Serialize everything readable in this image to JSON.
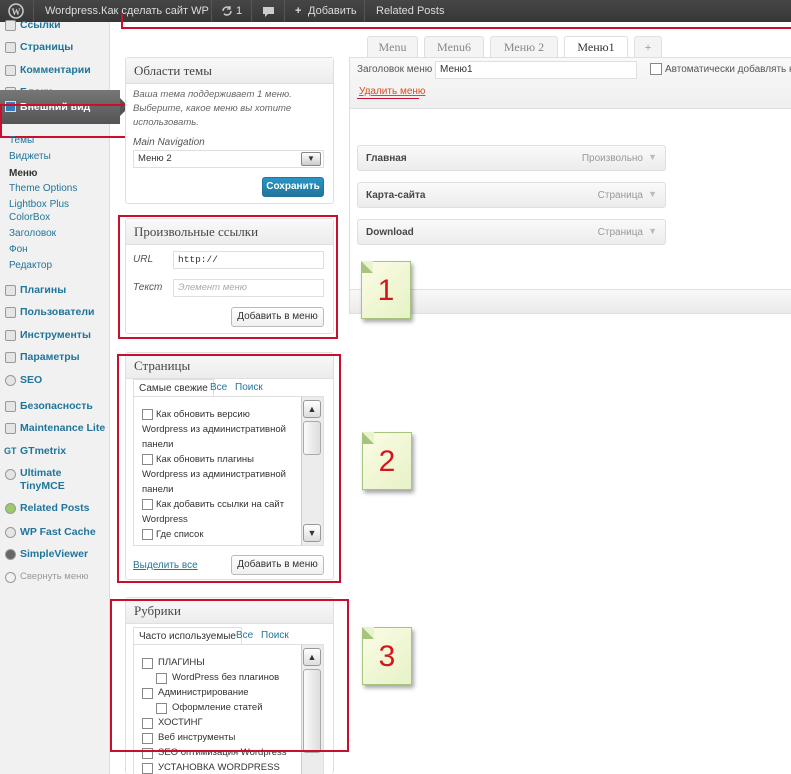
{
  "adminbar": {
    "site_title": "Wordpress.Как сделать сайт WP",
    "updates_count": "1",
    "add_label": "Добавить",
    "related_posts": "Related Posts"
  },
  "sidebar": {
    "top_items": [
      "Ссылки",
      "Страницы",
      "Комментарии",
      "Блоки"
    ],
    "active": "Внешний вид",
    "submenu": [
      "Темы",
      "Виджеты",
      "Меню",
      "Theme Options",
      "Lightbox Plus",
      "ColorBox",
      "Заголовок",
      "Фон",
      "Редактор"
    ],
    "bottom_items": [
      "Плагины",
      "Пользователи",
      "Инструменты",
      "Параметры",
      "SEO",
      "Безопасность",
      "Maintenance Lite",
      "GTmetrix",
      "Ultimate TinyMCE",
      "Related Posts",
      "WP Fast Cache",
      "SimpleViewer"
    ],
    "gt_prefix": "GT",
    "collapse": "Свернуть меню"
  },
  "theme_areas": {
    "title": "Области темы",
    "description": "Ваша тема поддерживает 1 меню. Выберите, какое меню вы хотите использовать.",
    "location_label": "Main Navigation",
    "selected_menu": "Меню 2",
    "save": "Сохранить"
  },
  "custom_links": {
    "title": "Произвольные ссылки",
    "url_label": "URL",
    "url_value": "http://",
    "text_label": "Текст",
    "text_placeholder": "Элемент меню",
    "add": "Добавить в меню"
  },
  "pages": {
    "title": "Страницы",
    "tabs": [
      "Самые свежие",
      "Все",
      "Поиск"
    ],
    "items": [
      "Как обновить версию Wordpress из административной панели",
      "Как обновить плагины Wordpress из административной панели",
      "Как добавить ссылки на сайт Wordpress",
      "Где список"
    ],
    "select_all": "Выделить все",
    "add": "Добавить в меню"
  },
  "categories": {
    "title": "Рубрики",
    "tabs": [
      "Часто используемые",
      "Все",
      "Поиск"
    ],
    "items": [
      "ПЛАГИНЫ",
      "WordPress без плагинов",
      "Администрирование",
      "Оформление статей",
      "ХОСТИНГ",
      "Веб инструменты",
      "SEO оптимизация Wordpress",
      "УСТАНОВКА WORDPRESS"
    ]
  },
  "menu_tabs": [
    "Menu",
    "Menu6",
    "Меню 2",
    "Меню1",
    "+"
  ],
  "menu_editor": {
    "name_label": "Заголовок меню",
    "name_value": "Меню1",
    "auto_add": "Автоматически добавлять но",
    "delete": "Удалить меню",
    "items": [
      {
        "title": "Главная",
        "type": "Произвольно"
      },
      {
        "title": "Карта-сайта",
        "type": "Страница"
      },
      {
        "title": "Download",
        "type": "Страница"
      }
    ]
  },
  "notes": [
    "1",
    "2",
    "3"
  ],
  "colors": {
    "annotation": "#c8102e",
    "link": "#21759b",
    "note_text": "#d4171c"
  }
}
